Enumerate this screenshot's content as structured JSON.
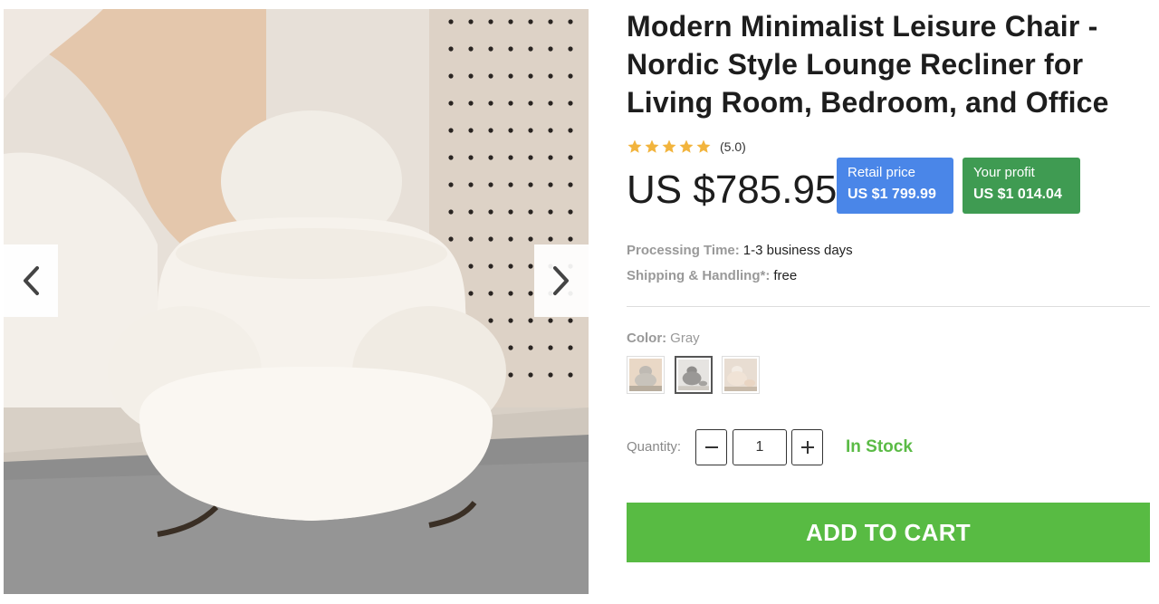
{
  "product": {
    "title": "Modern Minimalist Leisure Chair - Nordic Style Lounge Recliner for Living Room, Bedroom, and Office",
    "rating_value": 5.0,
    "rating_text": "(5.0)",
    "price": "US $785.95",
    "retail": {
      "label": "Retail price",
      "value": "US $1 799.99"
    },
    "profit": {
      "label": "Your profit",
      "value": "US $1 014.04"
    },
    "processing": {
      "label": "Processing Time:",
      "value": "1-3 business days"
    },
    "shipping": {
      "label": "Shipping & Handling*:",
      "value": "free"
    },
    "color": {
      "label": "Color:",
      "value": "Gray"
    },
    "quantity": {
      "label": "Quantity:",
      "value": "1"
    },
    "stock": "In Stock",
    "add_to_cart": "ADD TO CART"
  },
  "gallery": {
    "prev_icon": "chevron-left-icon",
    "next_icon": "chevron-right-icon"
  },
  "colors": {
    "star": "#f2b43d",
    "retail_badge": "#4a86e8",
    "profit_badge": "#3f9b52",
    "stock": "#5bbb46",
    "cart_button": "#58bb43"
  }
}
